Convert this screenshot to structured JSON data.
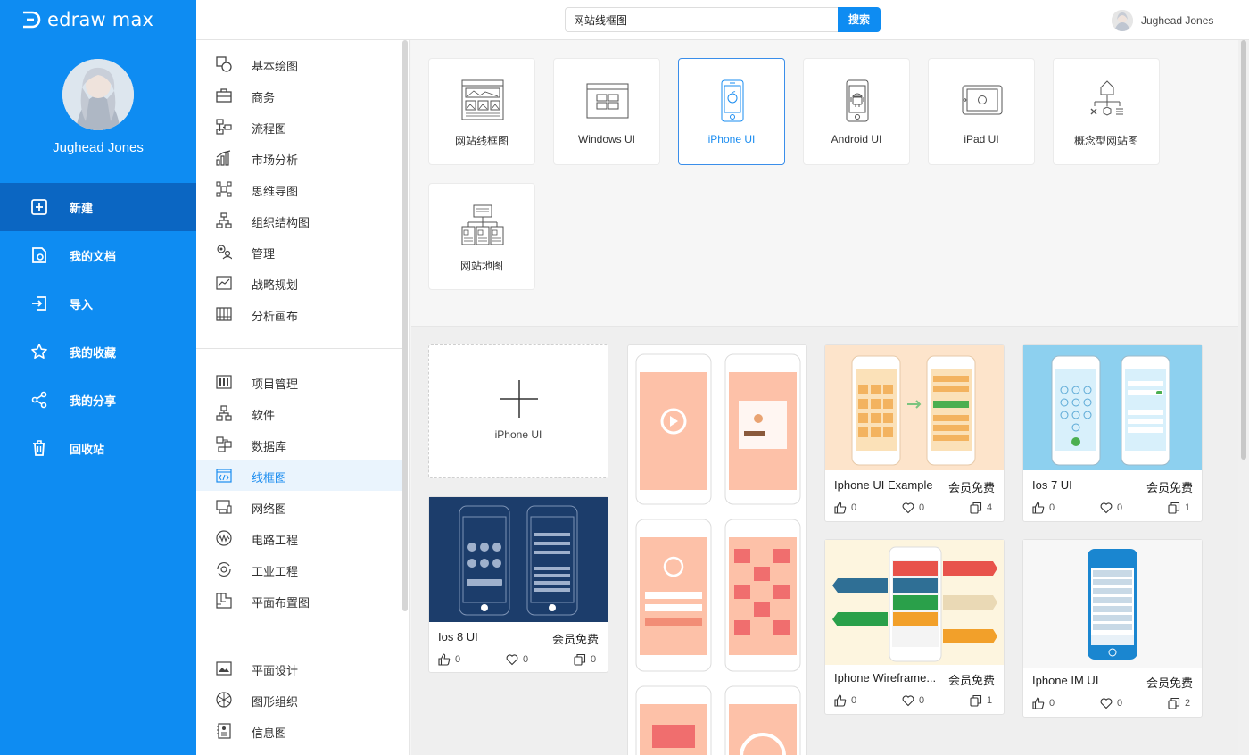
{
  "app": {
    "logo_text": "edraw max",
    "user_name": "Jughead Jones"
  },
  "nav": [
    {
      "label": "新建",
      "icon": "new-file-icon",
      "active": true
    },
    {
      "label": "我的文档",
      "icon": "documents-icon"
    },
    {
      "label": "导入",
      "icon": "import-icon"
    },
    {
      "label": "我的收藏",
      "icon": "star-icon"
    },
    {
      "label": "我的分享",
      "icon": "share-icon"
    },
    {
      "label": "回收站",
      "icon": "trash-icon"
    }
  ],
  "search": {
    "value": "网站线框图",
    "button_label": "搜索"
  },
  "categories_group1": [
    "基本绘图",
    "商务",
    "流程图",
    "市场分析",
    "思维导图",
    "组织结构图",
    "管理",
    "战略规划",
    "分析画布"
  ],
  "categories_group2": [
    "项目管理",
    "软件",
    "数据库",
    "线框图",
    "网络图",
    "电路工程",
    "工业工程",
    "平面布置图"
  ],
  "categories_group3": [
    "平面设计",
    "图形组织",
    "信息图"
  ],
  "active_category": "线框图",
  "template_types": [
    {
      "label": "网站线框图",
      "icon": "website-wireframe-icon"
    },
    {
      "label": "Windows UI",
      "icon": "windows-ui-icon"
    },
    {
      "label": "iPhone UI",
      "icon": "iphone-ui-icon",
      "active": true
    },
    {
      "label": "Android UI",
      "icon": "android-ui-icon"
    },
    {
      "label": "iPad UI",
      "icon": "ipad-ui-icon"
    },
    {
      "label": "概念型网站图",
      "icon": "concept-site-icon"
    },
    {
      "label": "网站地图",
      "icon": "sitemap-icon"
    }
  ],
  "new_blank": {
    "label": "iPhone UI"
  },
  "templates": [
    {
      "title": "Ios 8 UI",
      "badge": "会员免费",
      "likes": "0",
      "favorites": "0",
      "copies": "0"
    },
    {
      "title": "Iphone UI Example",
      "badge": "会员免费",
      "likes": "0",
      "favorites": "0",
      "copies": "4"
    },
    {
      "title": "Ios 7 UI",
      "badge": "会员免费",
      "likes": "0",
      "favorites": "0",
      "copies": "1"
    },
    {
      "title": "Iphone Wireframe...",
      "badge": "会员免费",
      "likes": "0",
      "favorites": "0",
      "copies": "1"
    },
    {
      "title": "Iphone IM UI",
      "badge": "会员免费",
      "likes": "0",
      "favorites": "0",
      "copies": "2"
    }
  ],
  "colors": {
    "primary": "#0e8cf2",
    "nav_active": "#0b66c2",
    "salmon": "#fdc1a8",
    "navy": "#1c3d6b"
  }
}
